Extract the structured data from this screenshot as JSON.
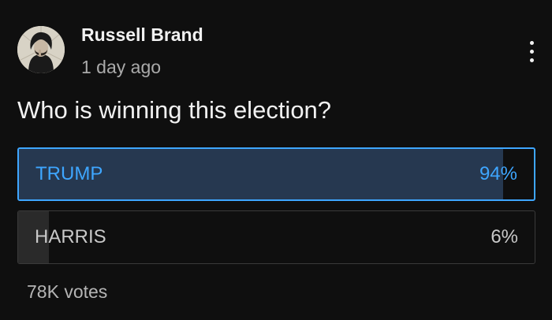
{
  "post": {
    "author": "Russell Brand",
    "timestamp": "1 day ago",
    "avatar_icon": "user-avatar",
    "menu_icon": "more-vertical-icon"
  },
  "poll": {
    "question": "Who is winning this election?",
    "options": [
      {
        "label": "TRUMP",
        "percent_text": "94%",
        "percent": 94,
        "selected": true
      },
      {
        "label": "HARRIS",
        "percent_text": "6%",
        "percent": 6,
        "selected": false
      }
    ],
    "votes_text": "78K votes"
  },
  "colors": {
    "background": "#0f0f0f",
    "accent": "#3ea6ff",
    "selected_fill": "#263850",
    "unselected_fill": "#2a2a2a"
  }
}
